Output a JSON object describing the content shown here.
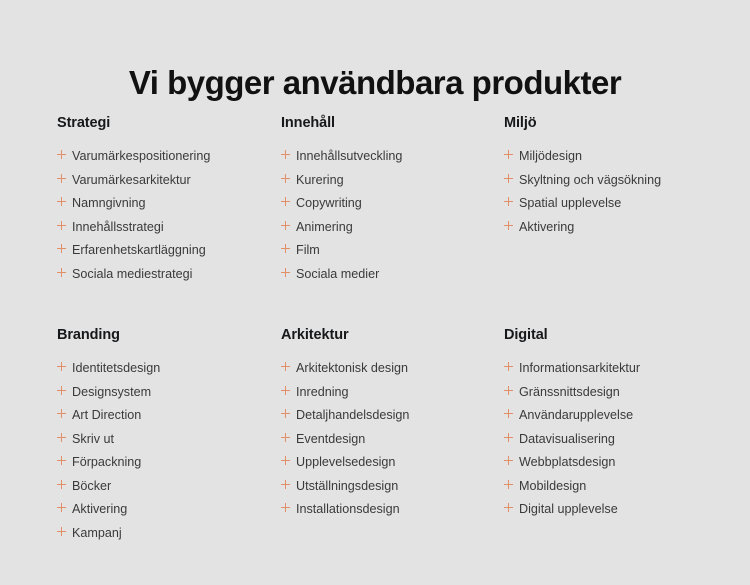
{
  "page": {
    "title": "Vi bygger användbara produkter",
    "background_color": "#e3e3e3",
    "accent_color": "#e28f68",
    "heading_color": "#17181a",
    "item_text_color": "#3a3a3a"
  },
  "groups": [
    {
      "title": "Strategi",
      "items": [
        "Varumärkespositionering",
        "Varumärkesarkitektur",
        "Namngivning",
        "Innehållsstrategi",
        "Erfarenhetskartläggning",
        "Sociala mediestrategi"
      ]
    },
    {
      "title": "Innehåll",
      "items": [
        "Innehållsutveckling",
        "Kurering",
        "Copywriting",
        "Animering",
        "Film",
        "Sociala medier"
      ]
    },
    {
      "title": "Miljö",
      "items": [
        "Miljödesign",
        "Skyltning och vägsökning",
        "Spatial upplevelse",
        "Aktivering"
      ]
    },
    {
      "title": "Branding",
      "items": [
        "Identitetsdesign",
        "Designsystem",
        "Art Direction",
        "Skriv ut",
        "Förpackning",
        "Böcker",
        "Aktivering",
        "Kampanj"
      ]
    },
    {
      "title": "Arkitektur",
      "items": [
        "Arkitektonisk design",
        "Inredning",
        "Detaljhandelsdesign",
        "Eventdesign",
        "Upplevelsedesign",
        "Utställningsdesign",
        "Installationsdesign"
      ]
    },
    {
      "title": "Digital",
      "items": [
        "Informationsarkitektur",
        "Gränssnittsdesign",
        "Användarupplevelse",
        "Datavisualisering",
        "Webbplatsdesign",
        "Mobildesign",
        "Digital upplevelse"
      ]
    }
  ],
  "icons": {
    "bullet": "plus-icon"
  }
}
